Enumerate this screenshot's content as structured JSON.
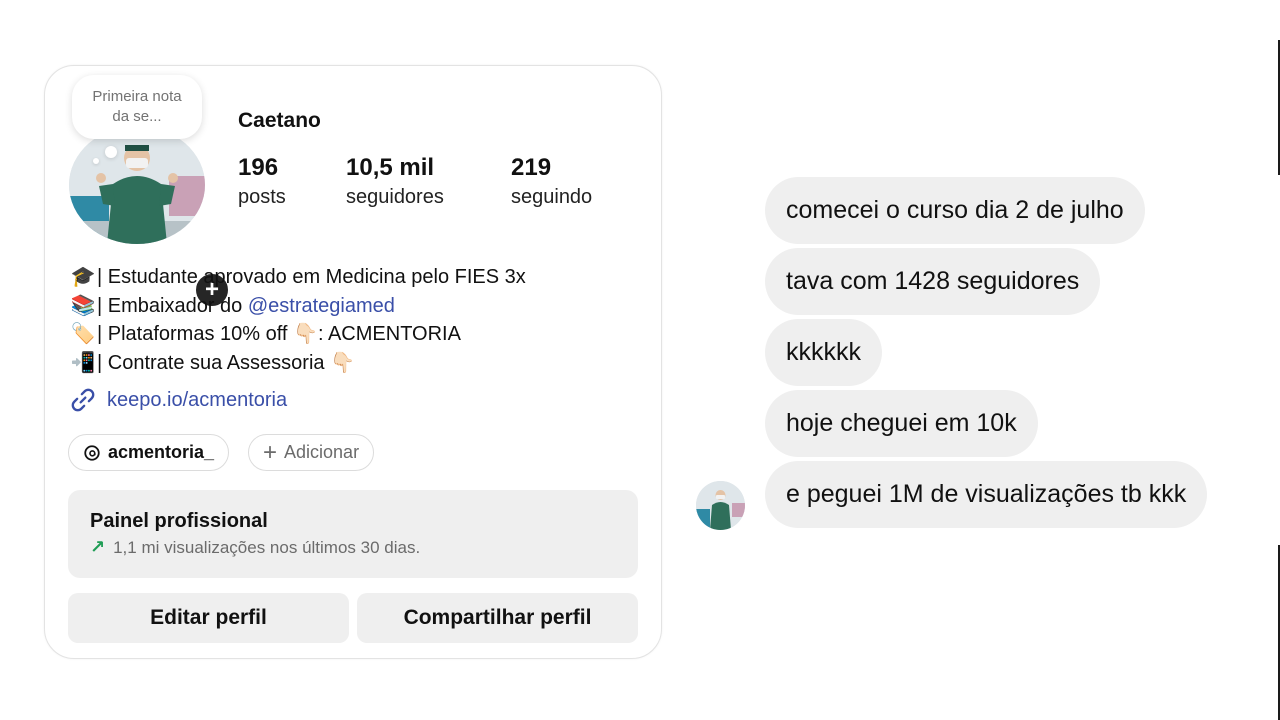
{
  "profile": {
    "note": "Primeira nota da se...",
    "username": "Caetano",
    "stats": {
      "posts_count": "196",
      "posts_label": "posts",
      "followers_count": "10,5 mil",
      "followers_label": "seguidores",
      "following_count": "219",
      "following_label": "seguindo"
    },
    "bio": {
      "line1_emoji": "🎓",
      "line1_text": "| Estudante aprovado em Medicina pelo FIES 3x",
      "line2_emoji": "📚",
      "line2_text": "| Embaixador do ",
      "line2_mention": "@estrategiamed",
      "line3_emoji": "🏷️",
      "line3_text_a": "| Plataformas 10% off ",
      "line3_pointer": "👇🏻",
      "line3_text_b": ": ACMENTORIA",
      "line4_emoji": "📲",
      "line4_text": "| Contrate sua Assessoria ",
      "line4_pointer": "👇🏻"
    },
    "link": "keepo.io/acmentoria",
    "threads_handle": "acmentoria_",
    "add_label": "Adicionar",
    "panel": {
      "title": "Painel profissional",
      "subtitle": "1,1 mi visualizações nos últimos 30 dias."
    },
    "edit_button": "Editar perfil",
    "share_button": "Compartilhar perfil"
  },
  "chat": {
    "messages": [
      "comecei o curso dia 2 de julho",
      "tava com 1428 seguidores",
      "kkkkkk",
      "hoje cheguei em 10k",
      "e peguei 1M de visualizações tb kkk"
    ]
  },
  "colors": {
    "link_blue": "#3a4fa8",
    "bubble_gray": "#efefef",
    "trend_green": "#1f9d55"
  }
}
